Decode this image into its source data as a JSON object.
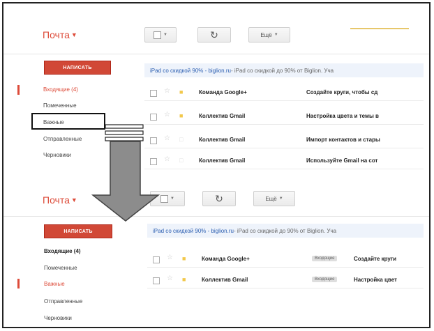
{
  "panel1": {
    "logo": "Почта",
    "compose_label": "НАПИСАТЬ",
    "toolbar": {
      "more_label": "Ещё"
    },
    "nav": [
      {
        "label": "Входящие (4)",
        "state": "active"
      },
      {
        "label": "Помеченные",
        "state": "normal"
      },
      {
        "label": "Важные",
        "state": "highlighted"
      },
      {
        "label": "Отправленные",
        "state": "normal"
      },
      {
        "label": "Черновики",
        "state": "normal"
      }
    ],
    "ad": {
      "link": "iPad со скидкой 90% - biglion.ru",
      "text": " - iPad со скидкой до 90% от Biglion. Уча"
    },
    "messages": [
      {
        "sender": "Команда Google+",
        "subject": "Создайте круги, чтобы сд",
        "important": true
      },
      {
        "sender": "Коллектив Gmail",
        "subject": "Настройка цвета и темы в",
        "important": true
      },
      {
        "sender": "Коллектив Gmail",
        "subject": "Импорт контактов и стары",
        "important": false
      },
      {
        "sender": "Коллектив Gmail",
        "subject": "Используйте Gmail на сот",
        "important": false
      }
    ]
  },
  "panel2": {
    "logo": "Почта",
    "compose_label": "НАПИСАТЬ",
    "toolbar": {
      "more_label": "Ещё"
    },
    "nav": [
      {
        "label": "Входящие (4)",
        "state": "bold"
      },
      {
        "label": "Помеченные",
        "state": "normal"
      },
      {
        "label": "Важные",
        "state": "active"
      },
      {
        "label": "Отправленные",
        "state": "normal"
      },
      {
        "label": "Черновики",
        "state": "normal"
      }
    ],
    "ad": {
      "link": "iPad со скидкой 90% - biglion.ru",
      "text": " - iPad со скидкой до 90% от Biglion. Уча"
    },
    "messages": [
      {
        "sender": "Команда Google+",
        "label": "Входящие",
        "subject": "Создайте круги"
      },
      {
        "sender": "Коллектив Gmail",
        "label": "Входящие",
        "subject": "Настройка цвет"
      }
    ]
  },
  "colors": {
    "brand_red": "#dd4b39",
    "arrow_gray": "#8c8c8c",
    "ad_bg": "#eef3fb"
  },
  "icons": {
    "refresh": "refresh-icon",
    "star": "star-icon",
    "important": "important-marker-icon",
    "arrow": "down-arrow-icon"
  }
}
